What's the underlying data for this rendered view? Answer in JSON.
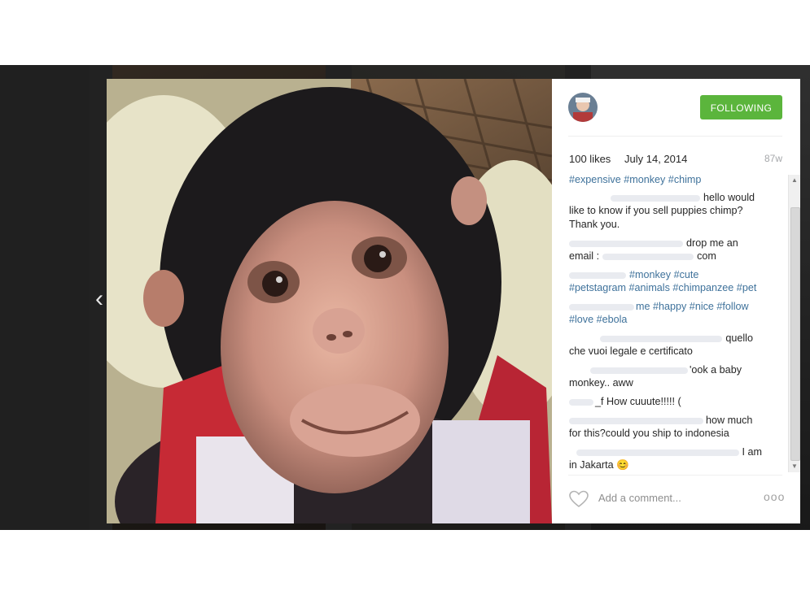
{
  "navigation": {
    "prev_glyph": "‹"
  },
  "post": {
    "follow_label": "FOLLOWING",
    "likes": "100 likes",
    "date": "July 14, 2014",
    "age": "87w",
    "accent_color": "#5bb53c",
    "hashtag_color": "#3f729b"
  },
  "comments": [
    {
      "text": "#expensive #monkey #chimp"
    },
    {
      "text": "hello would"
    },
    {
      "text": "like to know if you sell puppies chimp?"
    },
    {
      "text": "Thank you."
    },
    {
      "text": "drop me an"
    },
    {
      "text": "email :"
    },
    {
      "text": "com"
    },
    {
      "text": "#monkey #cute"
    },
    {
      "text": "#petstagram #animals #chimpanzee #pet"
    },
    {
      "text": "me #happy #nice #follow"
    },
    {
      "text": "#love #ebola"
    },
    {
      "text": "quello"
    },
    {
      "text": "che vuoi legale e certificato"
    },
    {
      "text": "'ook a baby"
    },
    {
      "text": "monkey.. aww"
    },
    {
      "text": "_f How cuuute!!!!! ("
    },
    {
      "text": "how much"
    },
    {
      "text": "for this?could you ship to indonesia"
    },
    {
      "text": "I am"
    },
    {
      "text": "in Jakarta 😊"
    }
  ],
  "composer": {
    "placeholder": "Add a comment...",
    "more_glyph": "ooo"
  },
  "icons": {
    "heart": "heart-icon",
    "avatar": "avatar",
    "chevron": "chevron-left-icon"
  }
}
